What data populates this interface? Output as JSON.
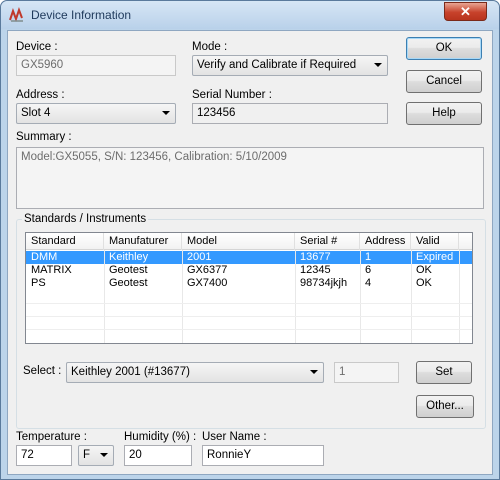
{
  "window": {
    "title": "Device Information",
    "close_label": "✕"
  },
  "labels": {
    "device": "Device :",
    "mode": "Mode :",
    "address": "Address :",
    "serial": "Serial Number :",
    "summary": "Summary :",
    "standards": "Standards / Instruments",
    "select": "Select :",
    "temperature": "Temperature :",
    "humidity": "Humidity (%) :",
    "username": "User Name :"
  },
  "fields": {
    "device": "GX5960",
    "mode": "Verify and Calibrate if Required",
    "address": "Slot 4",
    "serial": "123456",
    "summary": "Model:GX5055, S/N: 123456, Calibration: 5/10/2009",
    "select": "Keithley 2001 (#13677)",
    "select_number": "1",
    "temperature": "72",
    "temperature_unit": "F",
    "humidity": "20",
    "username": "RonnieY"
  },
  "buttons": {
    "ok": "OK",
    "cancel": "Cancel",
    "help": "Help",
    "set": "Set",
    "other": "Other..."
  },
  "table": {
    "columns": [
      "Standard",
      "Manufaturer",
      "Model",
      "Serial #",
      "Address",
      "Valid"
    ],
    "rows": [
      [
        "DMM",
        "Keithley",
        "2001",
        "13677",
        "1",
        "Expired"
      ],
      [
        "MATRIX",
        "Geotest",
        "GX6377",
        "12345",
        "6",
        "OK"
      ],
      [
        "PS",
        "Geotest",
        "GX7400",
        "98734jkjh",
        "4",
        "OK"
      ]
    ],
    "selected_row": 0
  },
  "colors": {
    "selection": "#3399ff",
    "titlebar_text": "#1e395b",
    "close_button": "#c7422b"
  },
  "icons": {
    "app": "signal-wave-icon",
    "dropdown": "chevron-down-icon"
  }
}
